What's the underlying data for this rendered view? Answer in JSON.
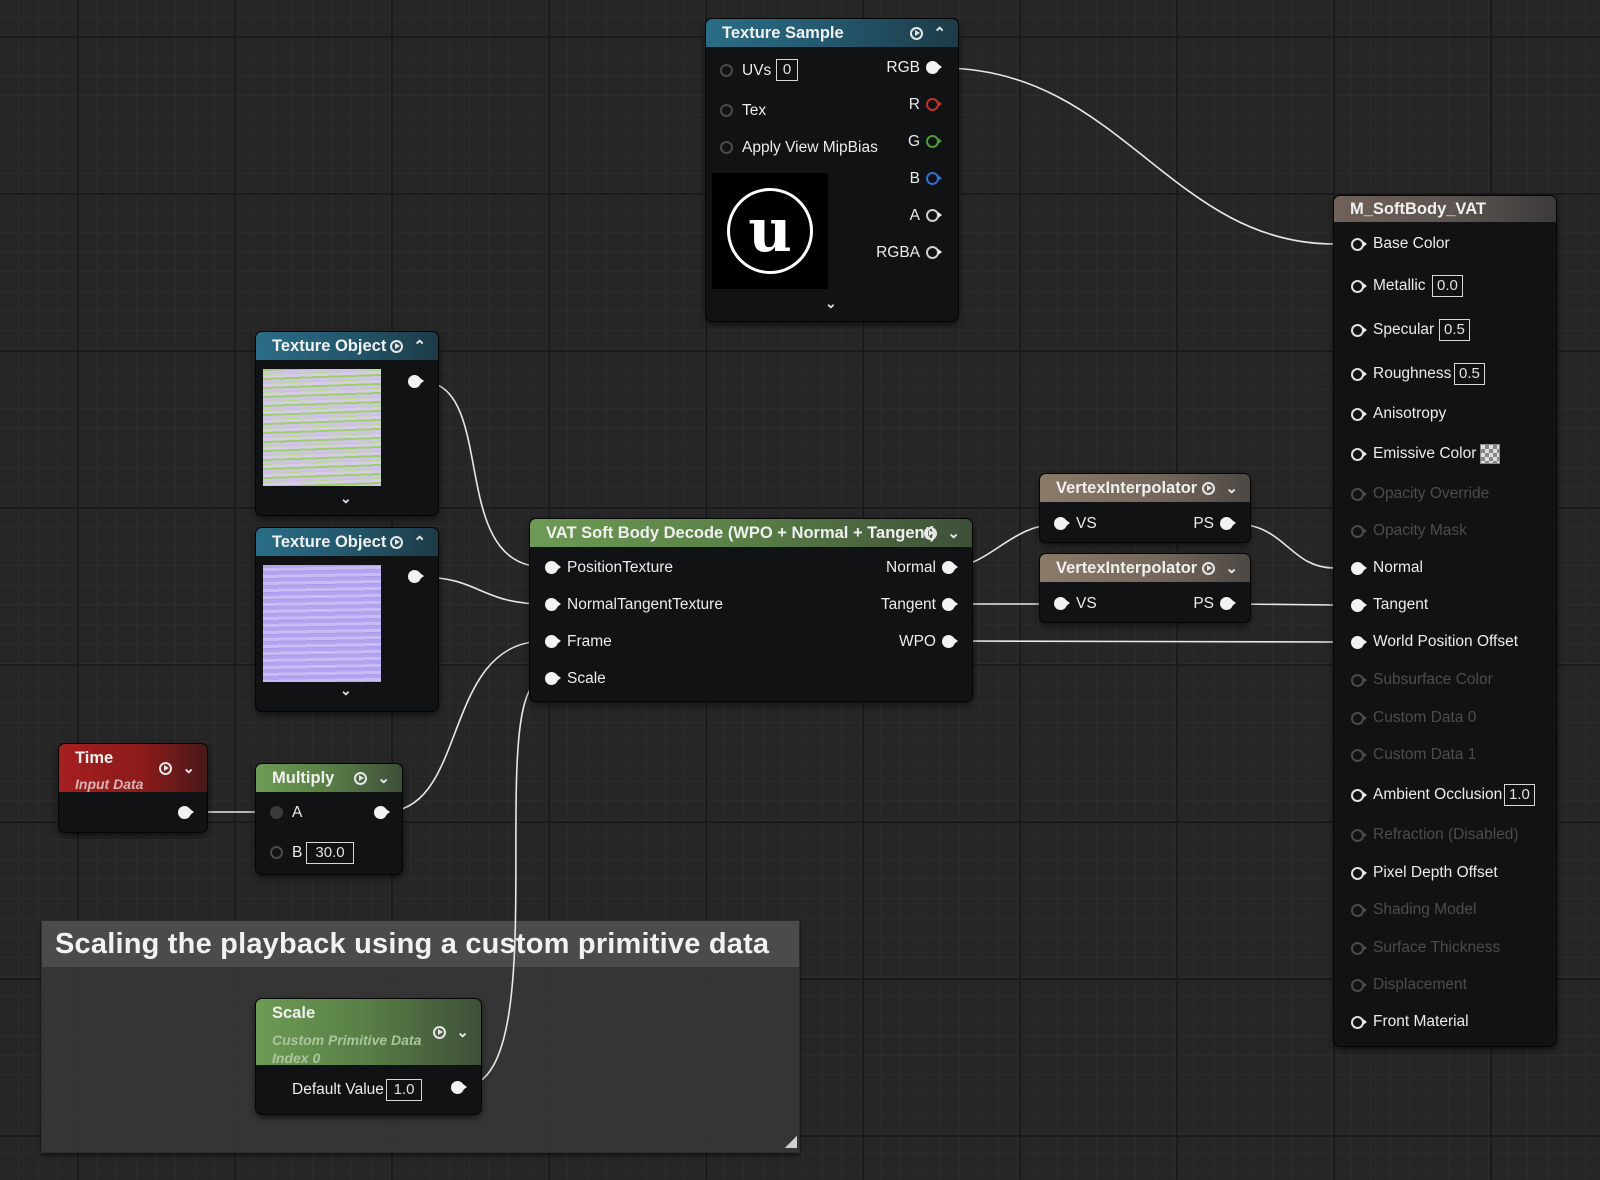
{
  "colors": {
    "background": "#262626",
    "node_body": "#111213",
    "pin_r": "#c0302a",
    "pin_g": "#4f9a3a",
    "pin_b": "#2f6fd0",
    "wire": "#e8e8e8"
  },
  "comment": {
    "title": "Scaling the playback using a custom primitive data"
  },
  "texture_sample": {
    "title": "Texture Sample",
    "inputs": {
      "uvs": "UVs",
      "uvs_value": "0",
      "tex": "Tex",
      "mipbias": "Apply View MipBias"
    },
    "outputs": {
      "rgb": "RGB",
      "r": "R",
      "g": "G",
      "b": "B",
      "a": "A",
      "rgba": "RGBA"
    },
    "preview_icon": "unreal-logo-icon"
  },
  "texture_object_1": {
    "title": "Texture Object",
    "preview": "position-texture-thumbnail"
  },
  "texture_object_2": {
    "title": "Texture Object",
    "preview": "normal-tangent-texture-thumbnail"
  },
  "vat_node": {
    "title": "VAT Soft Body Decode (WPO + Normal + Tangent)",
    "inputs": [
      "PositionTexture",
      "NormalTangentTexture",
      "Frame",
      "Scale"
    ],
    "outputs": [
      "Normal",
      "Tangent",
      "WPO"
    ]
  },
  "vertex_interp_1": {
    "title": "VertexInterpolator",
    "in": "VS",
    "out": "PS"
  },
  "vertex_interp_2": {
    "title": "VertexInterpolator",
    "in": "VS",
    "out": "PS"
  },
  "time_node": {
    "title": "Time",
    "subtitle": "Input Data"
  },
  "multiply_node": {
    "title": "Multiply",
    "a": "A",
    "b": "B",
    "b_value": "30.0"
  },
  "scale_node": {
    "title": "Scale",
    "subtitle_1": "Custom Primitive Data",
    "subtitle_2": "Index 0",
    "default_label": "Default Value",
    "default_value": "1.0"
  },
  "material": {
    "title": "M_SoftBody_VAT",
    "pins": {
      "base_color": "Base Color",
      "metallic": "Metallic",
      "metallic_value": "0.0",
      "specular": "Specular",
      "specular_value": "0.5",
      "roughness": "Roughness",
      "roughness_value": "0.5",
      "anisotropy": "Anisotropy",
      "emissive": "Emissive Color",
      "opacity_override": "Opacity Override",
      "opacity_mask": "Opacity Mask",
      "normal": "Normal",
      "tangent": "Tangent",
      "wpo": "World Position Offset",
      "subsurface": "Subsurface Color",
      "custom0": "Custom Data 0",
      "custom1": "Custom Data 1",
      "ao": "Ambient Occlusion",
      "ao_value": "1.0",
      "refraction": "Refraction (Disabled)",
      "pdo": "Pixel Depth Offset",
      "shading_model": "Shading Model",
      "surface_thickness": "Surface Thickness",
      "displacement": "Displacement",
      "front_material": "Front Material"
    }
  }
}
